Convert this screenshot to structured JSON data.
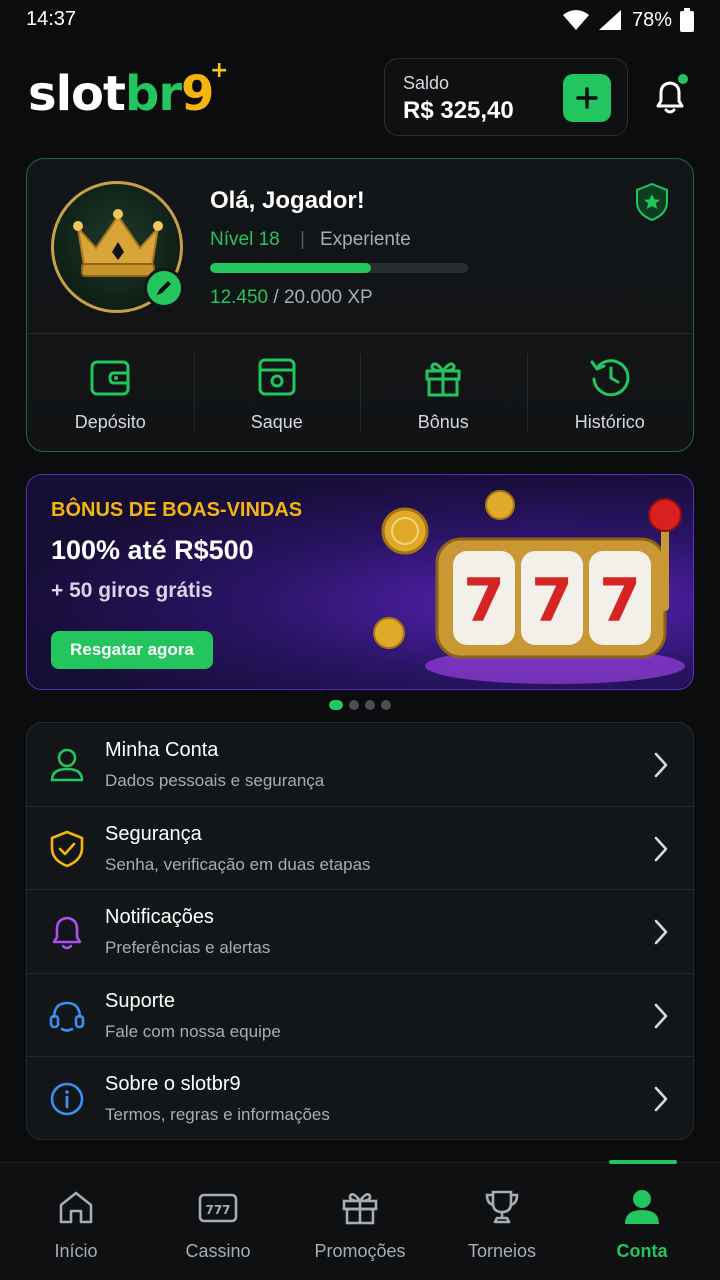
{
  "status_bar": {
    "time": "14:37",
    "battery": "78%"
  },
  "header": {
    "logo": {
      "part1": "slot",
      "part2": "br",
      "part3": "9",
      "spark": "+"
    },
    "balance_label": "Saldo",
    "balance_value": "R$ 325,40"
  },
  "profile": {
    "greeting": "Olá, Jogador!",
    "level": "Nível 18",
    "separator": "|",
    "rank": "Experiente",
    "xp_current": "12.450",
    "xp_total": " / 20.000 XP",
    "xp_progress": 0.6225,
    "actions": [
      {
        "label": "Depósito",
        "icon": "wallet-icon"
      },
      {
        "label": "Saque",
        "icon": "withdraw-icon"
      },
      {
        "label": "Bônus",
        "icon": "gift-icon"
      },
      {
        "label": "Histórico",
        "icon": "history-icon"
      }
    ]
  },
  "banner": {
    "eyebrow": "BÔNUS DE BOAS-VINDAS",
    "headline": "100% até R$500",
    "sub": "+ 50 giros grátis",
    "cta": "Resgatar agora",
    "slot_digits": [
      "7",
      "7",
      "7"
    ]
  },
  "carousel": {
    "active_index": 0,
    "count": 4
  },
  "menu": [
    {
      "title": "Minha Conta",
      "subtitle": "Dados pessoais e segurança",
      "icon": "user-icon",
      "color": "#22c55e"
    },
    {
      "title": "Segurança",
      "subtitle": "Senha, verificação em duas etapas",
      "icon": "shield-check-icon",
      "color": "#f5b50f"
    },
    {
      "title": "Notificações",
      "subtitle": "Preferências e alertas",
      "icon": "bell-icon",
      "color": "#b14ef0"
    },
    {
      "title": "Suporte",
      "subtitle": "Fale com nossa equipe",
      "icon": "headset-icon",
      "color": "#3b8ff0"
    },
    {
      "title": "Sobre o slotbr9",
      "subtitle": "Termos, regras e informações",
      "icon": "info-icon",
      "color": "#3b8ff0"
    }
  ],
  "bottom_nav": [
    {
      "label": "Início",
      "icon": "home-icon",
      "active": false
    },
    {
      "label": "Cassino",
      "icon": "slot-machine-icon",
      "slot_text": "777",
      "active": false
    },
    {
      "label": "Promoções",
      "icon": "gift-icon",
      "active": false
    },
    {
      "label": "Torneios",
      "icon": "trophy-icon",
      "active": false
    },
    {
      "label": "Conta",
      "icon": "user-icon",
      "active": true
    }
  ],
  "colors": {
    "accent": "#22c55e",
    "gold": "#f5b50f",
    "purple": "#b14ef0",
    "blue": "#3b8ff0"
  }
}
